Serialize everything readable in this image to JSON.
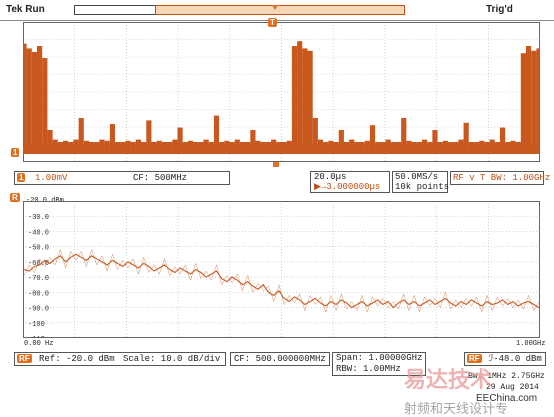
{
  "header": {
    "status": "Tek Run",
    "trigger_status": "Trig'd"
  },
  "time_panel": {
    "channel_label": "1",
    "scale": "1.00mV",
    "cf": "CF:   500MHz",
    "timebase": "20.0µs",
    "delay": "▶→3.000000µs",
    "sample_rate": "50.0MS/s",
    "record_length": "10k points",
    "rf_info": "RF v T BW: 1.00GHz"
  },
  "freq_panel": {
    "ref_line_label": "-20.0 dBm",
    "y_ticks": [
      "-20.0 dBm",
      "-30.0",
      "-40.0",
      "-50.0",
      "-60.0",
      "-70.0",
      "-80.0",
      "-90.0",
      "-100",
      "-110"
    ],
    "x_start": "0.00 Hz",
    "x_end": "1.00GHz",
    "ref": "Ref: -20.0 dBm",
    "scale": "Scale: 10.0 dB/div",
    "cf": "CF: 500.000000MHz",
    "span": "Span:   1.00000GHz",
    "rbw": "RBW:   1.00MHz",
    "marker": "ℐ-48.0 dBm",
    "bw_line": "BW: 1MHz   2.75GHz",
    "date": "29 Aug 2014",
    "watermark_cn": "易达技术",
    "watermark_en": "EEChina.com",
    "watermark_sub": "射频和天线设计专"
  },
  "colors": {
    "trace": "#c8581e",
    "grid": "#b8b8b8",
    "accent": "#e07020"
  },
  "chart_data": [
    {
      "type": "line",
      "title": "",
      "xlabel": "",
      "ylabel": "",
      "description_units": "time domain amplitude, arbitrary",
      "series": [
        {
          "values": [
            0.92,
            0.88,
            0.85,
            0.9,
            0.8,
            0.2,
            0.12,
            0.1,
            0.11,
            0.1,
            0.12,
            0.3,
            0.11,
            0.1,
            0.1,
            0.12,
            0.11,
            0.25,
            0.1,
            0.1,
            0.11,
            0.1,
            0.12,
            0.1,
            0.28,
            0.1,
            0.11,
            0.1,
            0.1,
            0.12,
            0.22,
            0.1,
            0.11,
            0.1,
            0.1,
            0.12,
            0.1,
            0.32,
            0.1,
            0.11,
            0.1,
            0.12,
            0.1,
            0.1,
            0.2,
            0.11,
            0.1,
            0.1,
            0.12,
            0.1,
            0.1,
            0.11,
            0.9,
            0.94,
            0.88,
            0.86,
            0.3,
            0.12,
            0.1,
            0.11,
            0.1,
            0.2,
            0.1,
            0.12,
            0.1,
            0.1,
            0.11,
            0.24,
            0.1,
            0.1,
            0.12,
            0.1,
            0.1,
            0.3,
            0.11,
            0.1,
            0.1,
            0.12,
            0.1,
            0.2,
            0.1,
            0.11,
            0.1,
            0.1,
            0.12,
            0.26,
            0.1,
            0.1,
            0.11,
            0.1,
            0.12,
            0.1,
            0.22,
            0.1,
            0.11,
            0.1,
            0.84,
            0.9,
            0.86,
            0.88
          ]
        }
      ]
    },
    {
      "type": "line",
      "title": "",
      "xlabel": "",
      "ylabel": "",
      "x_range": [
        0,
        1000
      ],
      "x_units": "MHz",
      "ylim": [
        -110,
        -20
      ],
      "y_units": "dBm",
      "series": [
        {
          "values": [
            -65,
            -66,
            -63,
            -62,
            -59,
            -61,
            -58,
            -56,
            -60,
            -57,
            -55,
            -57,
            -59,
            -56,
            -58,
            -60,
            -62,
            -59,
            -61,
            -63,
            -60,
            -62,
            -64,
            -61,
            -63,
            -66,
            -64,
            -62,
            -65,
            -67,
            -64,
            -66,
            -68,
            -65,
            -67,
            -70,
            -68,
            -66,
            -71,
            -73,
            -70,
            -72,
            -75,
            -73,
            -76,
            -78,
            -75,
            -80,
            -82,
            -79,
            -84,
            -86,
            -83,
            -85,
            -88,
            -86,
            -84,
            -87,
            -89,
            -86,
            -88,
            -85,
            -87,
            -90,
            -88,
            -86,
            -89,
            -87,
            -85,
            -88,
            -86,
            -90,
            -87,
            -85,
            -88,
            -86,
            -89,
            -87,
            -85,
            -88,
            -86,
            -84,
            -87,
            -89,
            -86,
            -88,
            -85,
            -87,
            -89,
            -86,
            -88,
            -87,
            -85,
            -88,
            -86,
            -89,
            -87,
            -86,
            -88,
            -90
          ]
        }
      ]
    }
  ]
}
